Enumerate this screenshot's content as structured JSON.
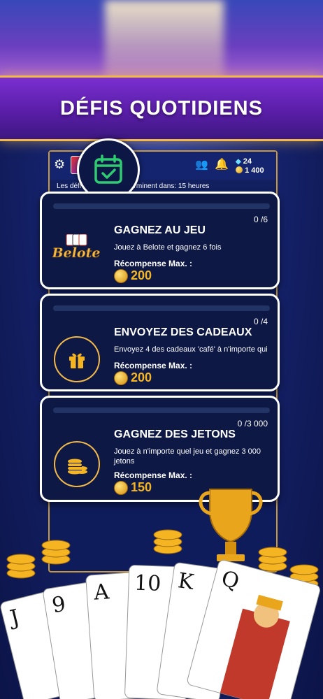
{
  "banner": {
    "title": "DÉFIS QUOTIDIENS"
  },
  "topbar": {
    "gems": "24",
    "coins": "1 400",
    "subtitle_prefix": "Les défi",
    "subtitle_suffix": "erminent dans: 15 heures"
  },
  "challenges": [
    {
      "title": "GAGNEZ AU JEU",
      "progress": "0 /6",
      "progress_fraction": 0,
      "description": "Jouez à Belote et gagnez 6 fois",
      "reward_label": "Récompense Max. :",
      "reward_value": "200",
      "icon": "belote-logo",
      "logo_text": "Belote"
    },
    {
      "title": "ENVOYEZ DES CADEAUX",
      "progress": "0 /4",
      "progress_fraction": 0,
      "description": "Envoyez 4 des cadeaux 'café' à n'importe qui",
      "reward_label": "Récompense Max. :",
      "reward_value": "200",
      "icon": "gift-icon"
    },
    {
      "title": "GAGNEZ DES JETONS",
      "progress": "0 /3 000",
      "progress_fraction": 0,
      "description": "Jouez à n'importe quel jeu et gagnez 3 000 jetons",
      "reward_label": "Récompense Max. :",
      "reward_value": "150",
      "icon": "coin-stack-icon"
    }
  ],
  "art": {
    "card_ranks": [
      "J",
      "9",
      "A",
      "10",
      "K",
      "Q"
    ]
  },
  "colors": {
    "gold": "#f2b94a",
    "panel": "#0d1845",
    "accent_green": "#2ecc71"
  }
}
